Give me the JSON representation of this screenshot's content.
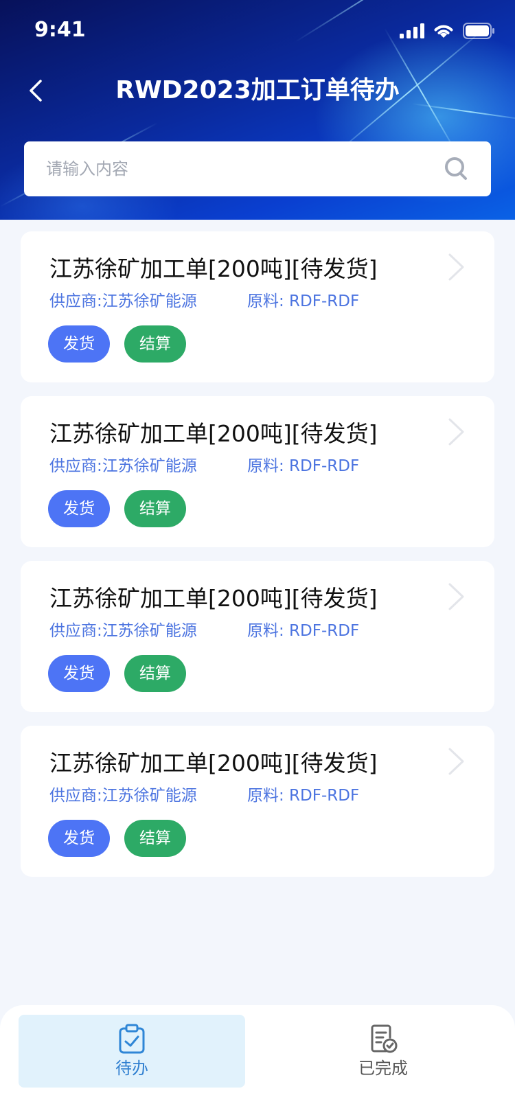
{
  "status_bar": {
    "time": "9:41"
  },
  "header": {
    "title": "RWD2023加工订单待办"
  },
  "search": {
    "placeholder": "请输入内容"
  },
  "orders": [
    {
      "title": "江苏徐矿加工单[200吨][待发货]",
      "supplier": "供应商:江苏徐矿能源",
      "material": "原料: RDF-RDF",
      "ship_label": "发货",
      "settle_label": "结算"
    },
    {
      "title": "江苏徐矿加工单[200吨][待发货]",
      "supplier": "供应商:江苏徐矿能源",
      "material": "原料: RDF-RDF",
      "ship_label": "发货",
      "settle_label": "结算"
    },
    {
      "title": "江苏徐矿加工单[200吨][待发货]",
      "supplier": "供应商:江苏徐矿能源",
      "material": "原料: RDF-RDF",
      "ship_label": "发货",
      "settle_label": "结算"
    },
    {
      "title": "江苏徐矿加工单[200吨][待发货]",
      "supplier": "供应商:江苏徐矿能源",
      "material": "原料: RDF-RDF",
      "ship_label": "发货",
      "settle_label": "结算"
    }
  ],
  "tabbar": {
    "todo_label": "待办",
    "done_label": "已完成",
    "active": "todo"
  },
  "colors": {
    "ship_button": "#4d74f5",
    "settle_button": "#2daa66",
    "meta_text": "#4c74e0",
    "active_tab_bg": "#e1f2fc"
  }
}
